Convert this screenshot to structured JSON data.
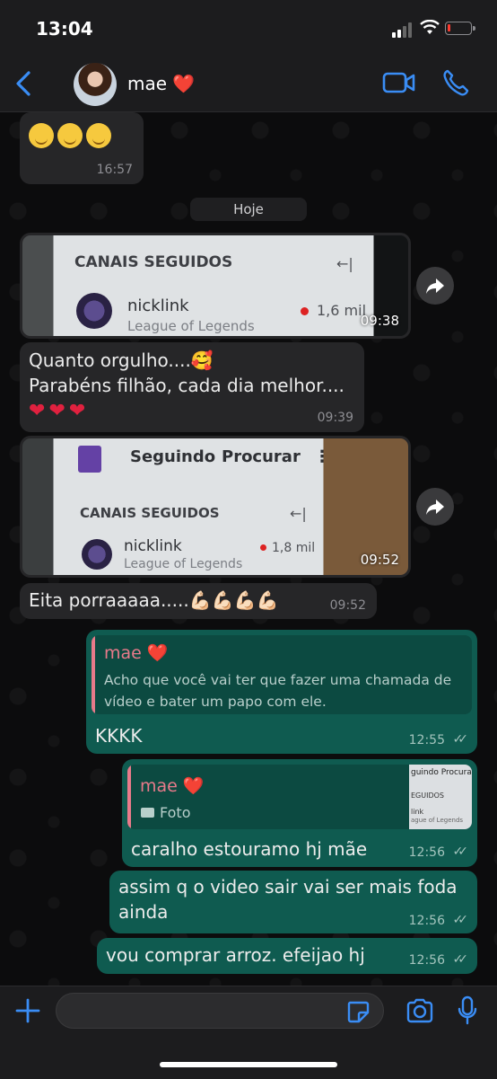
{
  "status_bar": {
    "time": "13:04"
  },
  "header": {
    "contact_name": "mae",
    "contact_emoji": "❤️"
  },
  "chat": {
    "msg1": {
      "emoji": "🤤 ☺️ 😂",
      "time": "16:57"
    },
    "day_chip": "Hoje",
    "photo1": {
      "title": "CANAIS SEGUIDOS",
      "arrow": "←|",
      "channel": "nicklink",
      "game": "League of Legends",
      "count": "1,6 mil",
      "time": "09:38"
    },
    "msg2": {
      "line1": "Quanto orgulho....🥰",
      "line2": "Parabéns filhão, cada dia melhor....",
      "line3": "❤️ ❤️ ❤️",
      "time": "09:39"
    },
    "photo2": {
      "tab1": "Seguindo",
      "tab2": "Procurar",
      "menu": "⋮",
      "title": "CANAIS SEGUIDOS",
      "arrow": "←|",
      "channel": "nicklink",
      "game": "League of Legends",
      "count": "1,8 mil",
      "time": "09:52"
    },
    "msg3": {
      "text": "Eita porraaaaa.....💪🏻💪🏻💪🏻💪🏻",
      "time": "09:52"
    },
    "msg4": {
      "quote_name": "mae ❤️",
      "quote_text": "Acho que você vai ter que fazer uma chamada de vídeo e bater um papo com ele.",
      "text": "KKKK",
      "time": "12:55"
    },
    "msg5": {
      "quote_name": "mae ❤️",
      "quote_label": "Foto",
      "thumb_title": "guindo   Procurar",
      "thumb_sub": "EGUIDOS",
      "thumb_name": "link",
      "thumb_game": "ague of Legends",
      "text": "caralho estouramo hj mãe",
      "time": "12:56"
    },
    "msg6": {
      "line1": "assim q o video sair vai ser mais foda",
      "line2": "ainda",
      "time": "12:56"
    },
    "msg7": {
      "text": "vou comprar arroz. efeijao hj",
      "time": "12:56"
    }
  },
  "colors": {
    "accent": "#3a8df5",
    "outgoing_bubble": "#0f5b50",
    "incoming_bubble": "#262628",
    "quote_name": "#e87a8a"
  },
  "icons": [
    "back-chevron-icon",
    "video-call-icon",
    "phone-icon",
    "forward-icon",
    "camera-icon",
    "plus-icon",
    "sticker-icon",
    "mic-icon"
  ]
}
